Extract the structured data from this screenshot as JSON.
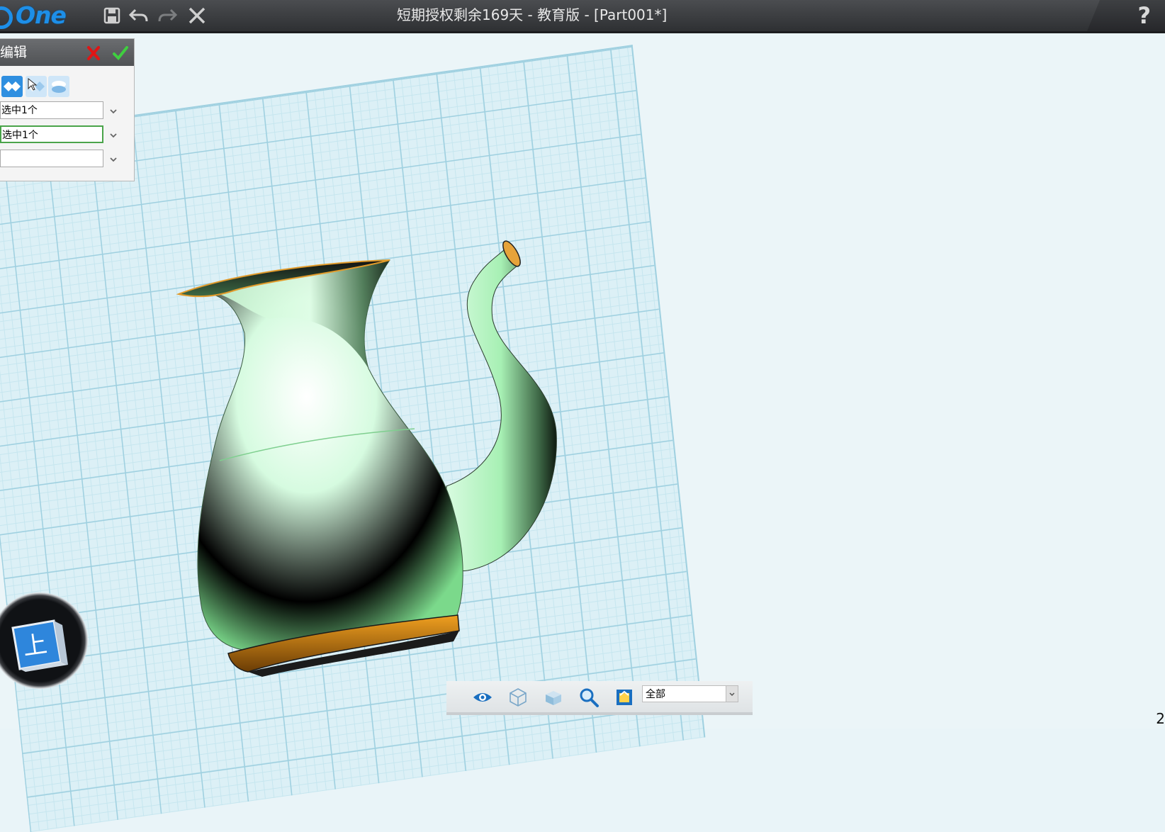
{
  "titlebar": {
    "logo_text": "One",
    "title": "短期授权剩余169天 - 教育版 - [Part001*]",
    "help": "?",
    "icons": [
      "save-icon",
      "undo-icon",
      "redo-icon",
      "close-icon"
    ]
  },
  "edit_panel": {
    "title": "编辑",
    "cancel_icon": "red-x-icon",
    "confirm_icon": "green-check-icon",
    "mode_icons": [
      "mode-both-icon",
      "mode-left-icon",
      "mode-stack-icon"
    ],
    "fields": [
      {
        "value": "选中1个"
      },
      {
        "value": "选中1个"
      },
      {
        "value": ""
      }
    ]
  },
  "viewcube": {
    "face_label": "上"
  },
  "bottom_toolbar": {
    "icons": [
      "eye-icon",
      "cube-wire-icon",
      "cube-solid-icon",
      "zoom-icon",
      "fit-view-icon"
    ],
    "filter_value": "全部"
  },
  "corner_text": "2",
  "colors": {
    "accent": "#1d8fe8",
    "model_green": "#a8f0b4",
    "grid_line": "#9fd0e0",
    "title_bg": "#3a3c3f"
  }
}
